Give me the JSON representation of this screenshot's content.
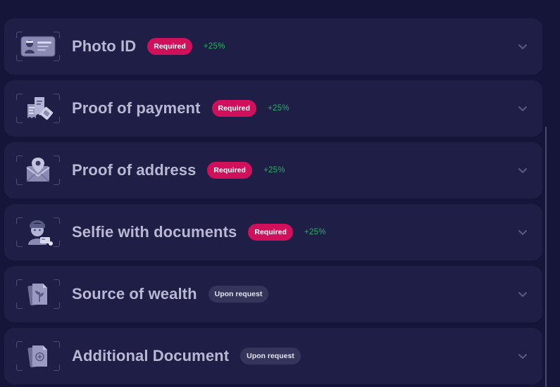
{
  "documents": [
    {
      "title": "Photo ID",
      "badge": "Required",
      "badge_type": "required",
      "bonus": "+25%",
      "icon": "id-card-icon"
    },
    {
      "title": "Proof of payment",
      "badge": "Required",
      "badge_type": "required",
      "bonus": "+25%",
      "icon": "receipts-icon"
    },
    {
      "title": "Proof of address",
      "badge": "Required",
      "badge_type": "required",
      "bonus": "+25%",
      "icon": "location-envelope-icon"
    },
    {
      "title": "Selfie with documents",
      "badge": "Required",
      "badge_type": "required",
      "bonus": "+25%",
      "icon": "selfie-icon"
    },
    {
      "title": "Source of wealth",
      "badge": "Upon request",
      "badge_type": "request",
      "bonus": "",
      "icon": "wealth-document-icon"
    },
    {
      "title": "Additional Document",
      "badge": "Upon request",
      "badge_type": "request",
      "bonus": "",
      "icon": "additional-document-icon"
    }
  ],
  "colors": {
    "background": "#15153a",
    "card": "#1e1e46",
    "required_badge": "#d0105a",
    "request_badge": "#35355c",
    "bonus": "#1cb85c",
    "title": "#b8b8d2"
  }
}
